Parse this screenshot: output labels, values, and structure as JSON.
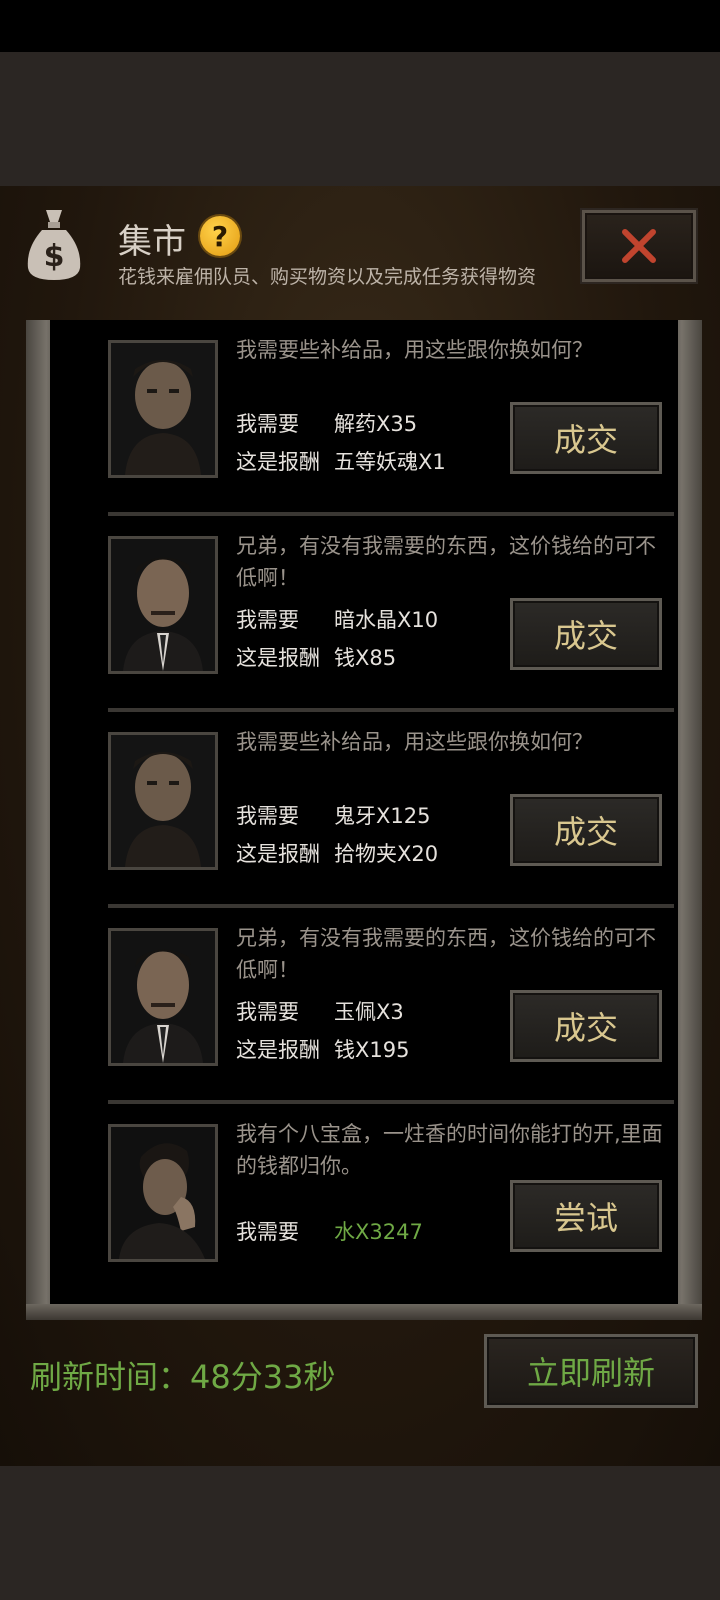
{
  "header": {
    "title": "集市",
    "help_icon": "question-mark-icon",
    "subtitle": "花钱来雇佣队员、购买物资以及完成任务获得物资",
    "close_icon": "close-x-icon"
  },
  "labels": {
    "need": "我需要",
    "reward": "这是报酬"
  },
  "trades": [
    {
      "portrait": "portrait-man-1",
      "message": "我需要些补给品，用这些跟你换如何？",
      "need_value": "解药X35",
      "reward_value": "五等妖魂X1",
      "button": "成交"
    },
    {
      "portrait": "portrait-man-2",
      "message": "兄弟，有没有我需要的东西，这价钱给的可不低啊！",
      "need_value": "暗水晶X10",
      "reward_value": "钱X85",
      "button": "成交"
    },
    {
      "portrait": "portrait-man-1",
      "message": "我需要些补给品，用这些跟你换如何？",
      "need_value": "鬼牙X125",
      "reward_value": "拾物夹X20",
      "button": "成交"
    },
    {
      "portrait": "portrait-man-2",
      "message": "兄弟，有没有我需要的东西，这价钱给的可不低啊！",
      "need_value": "玉佩X3",
      "reward_value": "钱X195",
      "button": "成交"
    },
    {
      "portrait": "portrait-man-3",
      "message": "我有个八宝盒，一炷香的时间你能打的开,里面的钱都归你。",
      "need_value": "水X3247",
      "button": "尝试"
    }
  ],
  "footer": {
    "refresh_time": "刷新时间：48分33秒",
    "refresh_button": "立即刷新"
  },
  "colors": {
    "accent_green": "#6fa945",
    "button_text_gold": "#d9c78f",
    "close_red": "#c0442e"
  }
}
